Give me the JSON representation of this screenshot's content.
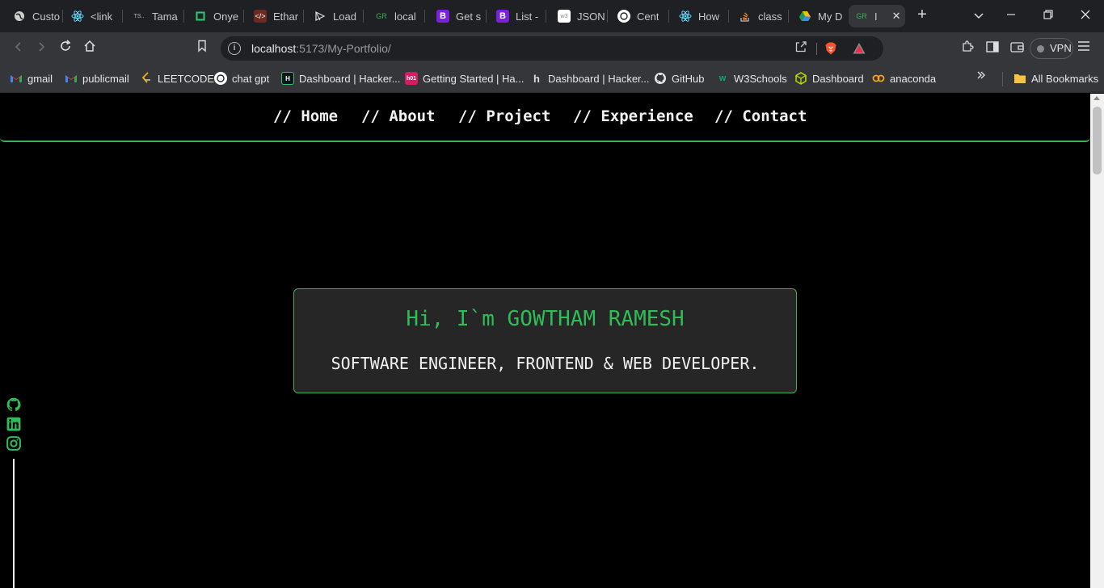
{
  "browser": {
    "tabs": [
      {
        "label": "Custo",
        "icon": "globe-icon"
      },
      {
        "label": "<link",
        "icon": "react-icon"
      },
      {
        "label": "Tama",
        "icon": "ts-icon"
      },
      {
        "label": "Onye",
        "icon": "square-icon"
      },
      {
        "label": "Ethar",
        "icon": "code-icon"
      },
      {
        "label": "Load",
        "icon": "triangle-icon"
      },
      {
        "label": "local",
        "icon": "gr-icon"
      },
      {
        "label": "Get s",
        "icon": "bootstrap-icon"
      },
      {
        "label": "List -",
        "icon": "bootstrap-icon"
      },
      {
        "label": "JSON",
        "icon": "w3-icon"
      },
      {
        "label": "Cent",
        "icon": "openai-icon"
      },
      {
        "label": "How",
        "icon": "react-icon"
      },
      {
        "label": "class",
        "icon": "stackoverflow-icon"
      },
      {
        "label": "My D",
        "icon": "drive-icon"
      },
      {
        "label": "I",
        "icon": "gr-icon"
      }
    ],
    "url_host": "localhost",
    "url_path": ":5173/My-Portfolio/",
    "vpn_label": "VPN"
  },
  "bookmarks": [
    {
      "label": "gmail",
      "icon": "gmail-icon"
    },
    {
      "label": "publicmail",
      "icon": "gmail-icon"
    },
    {
      "label": "LEETCODE",
      "icon": "leetcode-icon"
    },
    {
      "label": "chat gpt",
      "icon": "openai-icon"
    },
    {
      "label": "Dashboard | Hacker...",
      "icon": "hackerrank-icon"
    },
    {
      "label": "Getting Started | Ha...",
      "icon": "h101-icon"
    },
    {
      "label": "Dashboard | Hacker...",
      "icon": "hackerearth-icon"
    },
    {
      "label": "GitHub",
      "icon": "github-icon"
    },
    {
      "label": "W3Schools",
      "icon": "w3schools-icon"
    },
    {
      "label": "Dashboard",
      "icon": "cube-icon"
    },
    {
      "label": "anaconda",
      "icon": "anaconda-icon"
    }
  ],
  "all_bookmarks_label": "All Bookmarks",
  "site": {
    "nav": [
      "// Home",
      "// About",
      "// Project",
      "// Experience",
      "// Contact"
    ],
    "hero_title": "Hi, I`m GOWTHAM RAMESH",
    "hero_subtitle": "SOFTWARE ENGINEER, FRONTEND & WEB DEVELOPER.",
    "accent_color": "#3cb054",
    "social_icons": [
      "github-icon",
      "linkedin-icon",
      "instagram-icon"
    ]
  }
}
